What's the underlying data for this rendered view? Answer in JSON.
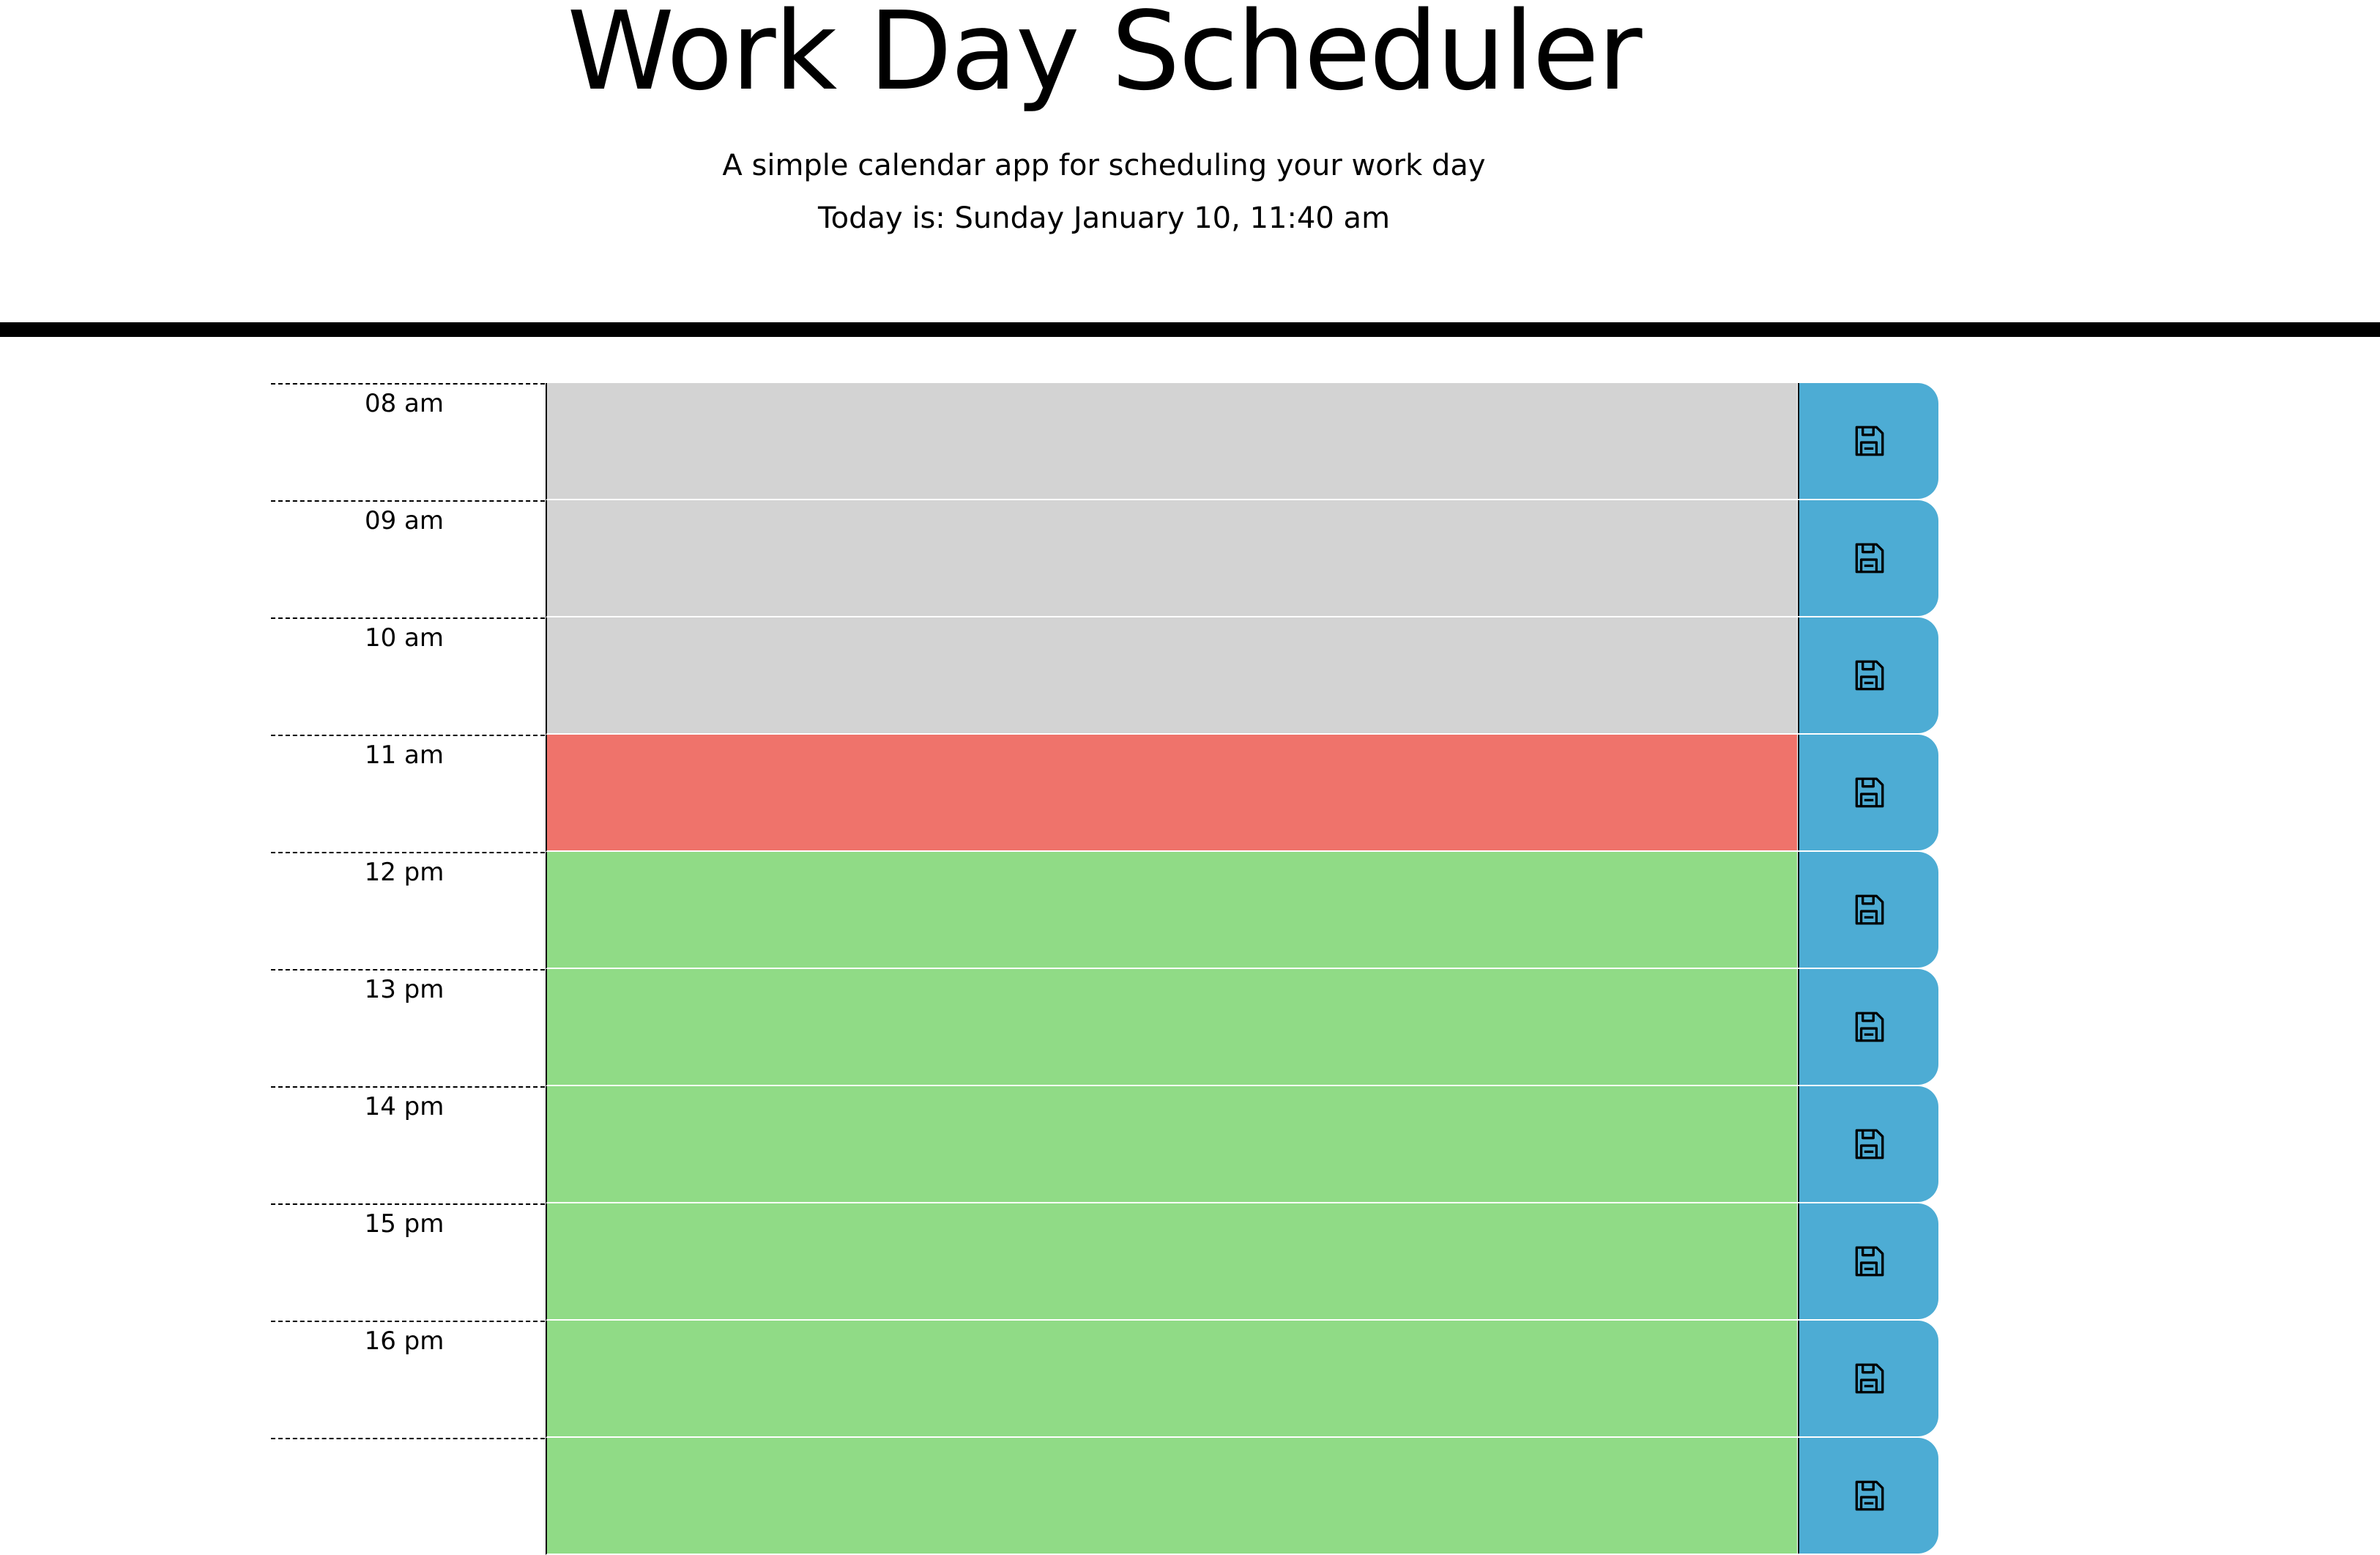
{
  "header": {
    "title": "Work Day Scheduler",
    "subtitle": "A simple calendar app for scheduling your work day",
    "today": "Today is: Sunday January 10, 11:40 am"
  },
  "colors": {
    "past": "#d3d3d3",
    "present": "#ef736b",
    "future": "#90db86",
    "save_button": "#4dacd4"
  },
  "time_blocks": [
    {
      "hour_label": "08 am",
      "status": "past",
      "description": "",
      "save_icon": "floppy-disk-icon"
    },
    {
      "hour_label": "09 am",
      "status": "past",
      "description": "",
      "save_icon": "floppy-disk-icon"
    },
    {
      "hour_label": "10 am",
      "status": "past",
      "description": "",
      "save_icon": "floppy-disk-icon"
    },
    {
      "hour_label": "11 am",
      "status": "present",
      "description": "",
      "save_icon": "floppy-disk-icon"
    },
    {
      "hour_label": "12 pm",
      "status": "future",
      "description": "",
      "save_icon": "floppy-disk-icon"
    },
    {
      "hour_label": "13 pm",
      "status": "future",
      "description": "",
      "save_icon": "floppy-disk-icon"
    },
    {
      "hour_label": "14 pm",
      "status": "future",
      "description": "",
      "save_icon": "floppy-disk-icon"
    },
    {
      "hour_label": "15 pm",
      "status": "future",
      "description": "",
      "save_icon": "floppy-disk-icon"
    },
    {
      "hour_label": "16 pm",
      "status": "future",
      "description": "",
      "save_icon": "floppy-disk-icon"
    },
    {
      "hour_label": "",
      "status": "future",
      "description": "",
      "save_icon": "floppy-disk-icon"
    }
  ]
}
